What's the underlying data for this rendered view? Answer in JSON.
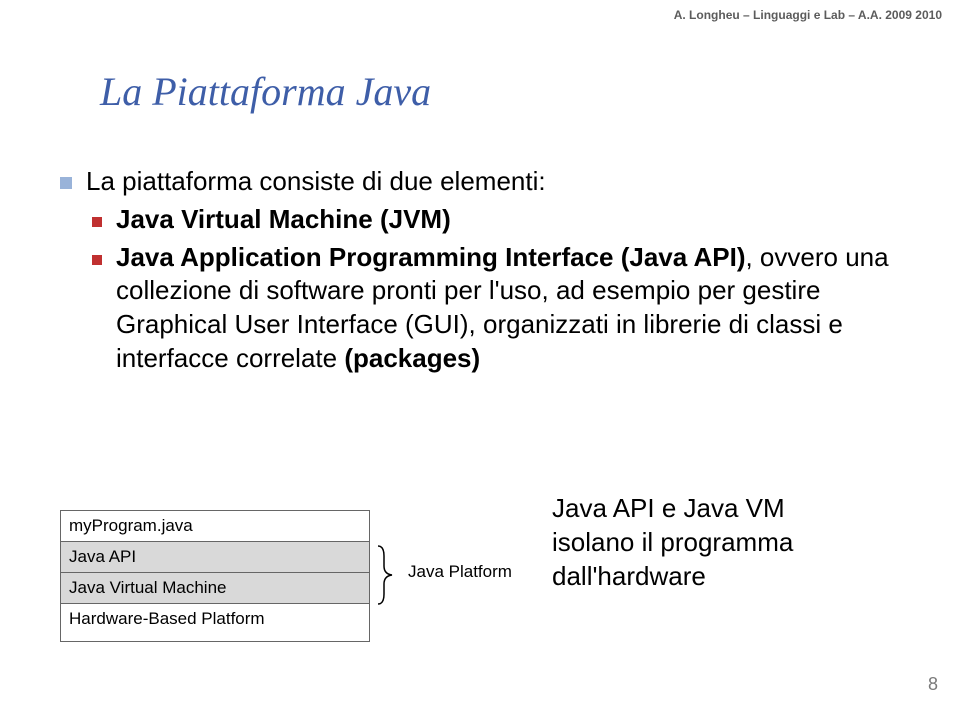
{
  "header": "A. Longheu – Linguaggi e Lab – A.A. 2009 2010",
  "title": "La Piattaforma Java",
  "bullet1": "La piattaforma consiste di due elementi:",
  "sub1_bold": "Java Virtual Machine (JVM)",
  "sub2_bold_start": "Java Application Programming Interface (Java API)",
  "sub2_rest": ", ovvero una collezione di software pronti per l'uso, ad esempio per gestire Graphical User Interface (GUI), organizzati in librerie di classi e interfacce correlate ",
  "sub2_bold_end": "(packages)",
  "diagram": {
    "row1": "myProgram.java",
    "row2": "Java API",
    "row3": "Java Virtual Machine",
    "row4": "Hardware-Based Platform",
    "platform": "Java Platform"
  },
  "caption_line1": "Java API e Java VM",
  "caption_line2": "isolano il programma",
  "caption_line3": "dall'hardware",
  "page_number": "8"
}
